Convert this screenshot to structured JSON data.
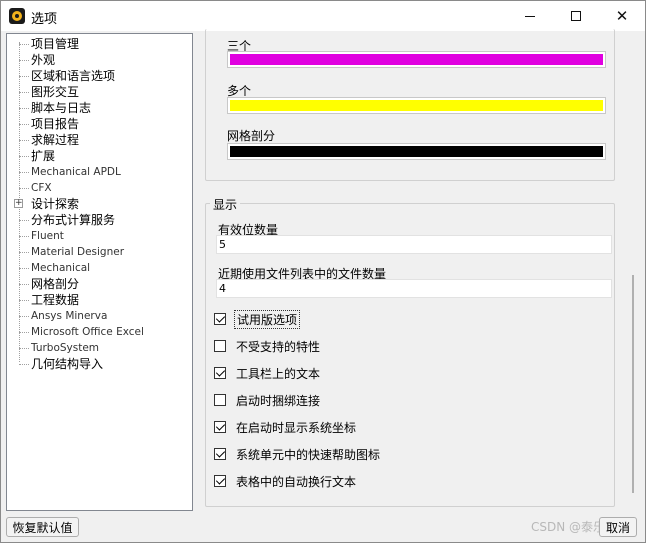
{
  "window": {
    "title": "选项",
    "minimize_glyph": "—",
    "maximize_glyph": "☐",
    "close_glyph": "✕"
  },
  "tree": {
    "items": [
      {
        "label": "项目管理",
        "lang": "zh"
      },
      {
        "label": "外观",
        "lang": "zh"
      },
      {
        "label": "区域和语言选项",
        "lang": "zh"
      },
      {
        "label": "图形交互",
        "lang": "zh"
      },
      {
        "label": "脚本与日志",
        "lang": "zh"
      },
      {
        "label": "项目报告",
        "lang": "zh"
      },
      {
        "label": "求解过程",
        "lang": "zh"
      },
      {
        "label": "扩展",
        "lang": "zh"
      },
      {
        "label": "Mechanical APDL",
        "lang": "en"
      },
      {
        "label": "CFX",
        "lang": "en"
      },
      {
        "label": "设计探索",
        "lang": "zh",
        "expandable": true,
        "expander": "+"
      },
      {
        "label": "分布式计算服务",
        "lang": "zh"
      },
      {
        "label": "Fluent",
        "lang": "en"
      },
      {
        "label": "Material Designer",
        "lang": "en"
      },
      {
        "label": "Mechanical",
        "lang": "en"
      },
      {
        "label": "网格剖分",
        "lang": "zh"
      },
      {
        "label": "工程数据",
        "lang": "zh"
      },
      {
        "label": "Ansys Minerva",
        "lang": "en"
      },
      {
        "label": "Microsoft Office Excel",
        "lang": "en"
      },
      {
        "label": "TurboSystem",
        "lang": "en"
      },
      {
        "label": "几何结构导入",
        "lang": "zh"
      }
    ]
  },
  "colors": {
    "items": [
      {
        "label": "三个",
        "color": "#e000e0"
      },
      {
        "label": "多个",
        "color": "#ffff00"
      },
      {
        "label": "网格剖分",
        "color": "#000000"
      }
    ]
  },
  "display": {
    "legend": "显示",
    "sig_digits_label": "有效位数量",
    "sig_digits_value": "5",
    "recent_files_label": "近期使用文件列表中的文件数量",
    "recent_files_value": "4",
    "checkboxes": [
      {
        "label": "试用版选项",
        "checked": true,
        "focused": true
      },
      {
        "label": "不受支持的特性",
        "checked": false
      },
      {
        "label": "工具栏上的文本",
        "checked": true
      },
      {
        "label": "启动时捆绑连接",
        "checked": false
      },
      {
        "label": "在启动时显示系统坐标",
        "checked": true
      },
      {
        "label": "系统单元中的快速帮助图标",
        "checked": true
      },
      {
        "label": "表格中的自动换行文本",
        "checked": true
      }
    ]
  },
  "buttons": {
    "reset": "恢复默认值",
    "cancel": "取消"
  },
  "watermark": "CSDN @泰乐"
}
